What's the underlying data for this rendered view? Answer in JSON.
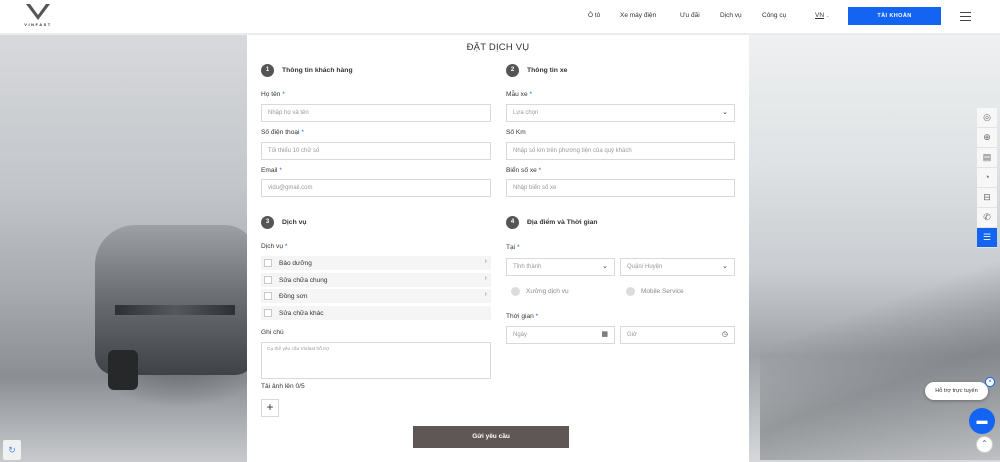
{
  "header": {
    "brand": "VINFAST",
    "nav": [
      "Ô tô",
      "Xe máy điện",
      "Ưu đãi",
      "Dịch vụ",
      "Công cụ"
    ],
    "lang": "VN",
    "account_label": "TÀI KHOẢN"
  },
  "form": {
    "title": "ĐẶT DỊCH VỤ",
    "required_mark": "*",
    "customer": {
      "num": "1",
      "heading": "Thông tin khách hàng",
      "name_label": "Họ tên",
      "name_placeholder": "Nhập họ và tên",
      "phone_label": "Số điện thoại",
      "phone_placeholder": "Tối thiểu 10 chữ số",
      "email_label": "Email",
      "email_placeholder": "vidu@gmail.com"
    },
    "vehicle": {
      "num": "2",
      "heading": "Thông tin xe",
      "model_label": "Mẫu xe",
      "model_placeholder": "Lựa chọn",
      "km_label": "Số Km",
      "km_placeholder": "Nhập số km trên phương tiện của quý khách",
      "plate_label": "Biển số xe",
      "plate_placeholder": "Nhập biển số xe"
    },
    "service": {
      "num": "3",
      "heading": "Dịch vụ",
      "label": "Dịch vụ",
      "options": [
        "Bảo dưỡng",
        "Sửa chữa chung",
        "Đồng sơn",
        "Sửa chữa khác"
      ],
      "note_label": "Ghi chú",
      "note_placeholder": "Cụ thể yêu cầu Vinfast hỗ trợ",
      "upload_label": "Tải ảnh lên 0/5",
      "upload_button": "+"
    },
    "location": {
      "num": "4",
      "heading": "Địa điểm và Thời gian",
      "at_label": "Tại",
      "city_placeholder": "Tỉnh thành",
      "district_placeholder": "Quận/ Huyện",
      "radio_workshop": "Xưởng dịch vụ",
      "radio_mobile": "Mobile Service",
      "time_label": "Thời gian",
      "date_placeholder": "Ngày",
      "hour_placeholder": "Giờ"
    },
    "submit_label": "Gửi yêu cầu"
  },
  "chat": {
    "bubble": "Hỗ trợ trực tuyến"
  },
  "colors": {
    "accent": "#1464f4",
    "submit": "#5e5755"
  }
}
